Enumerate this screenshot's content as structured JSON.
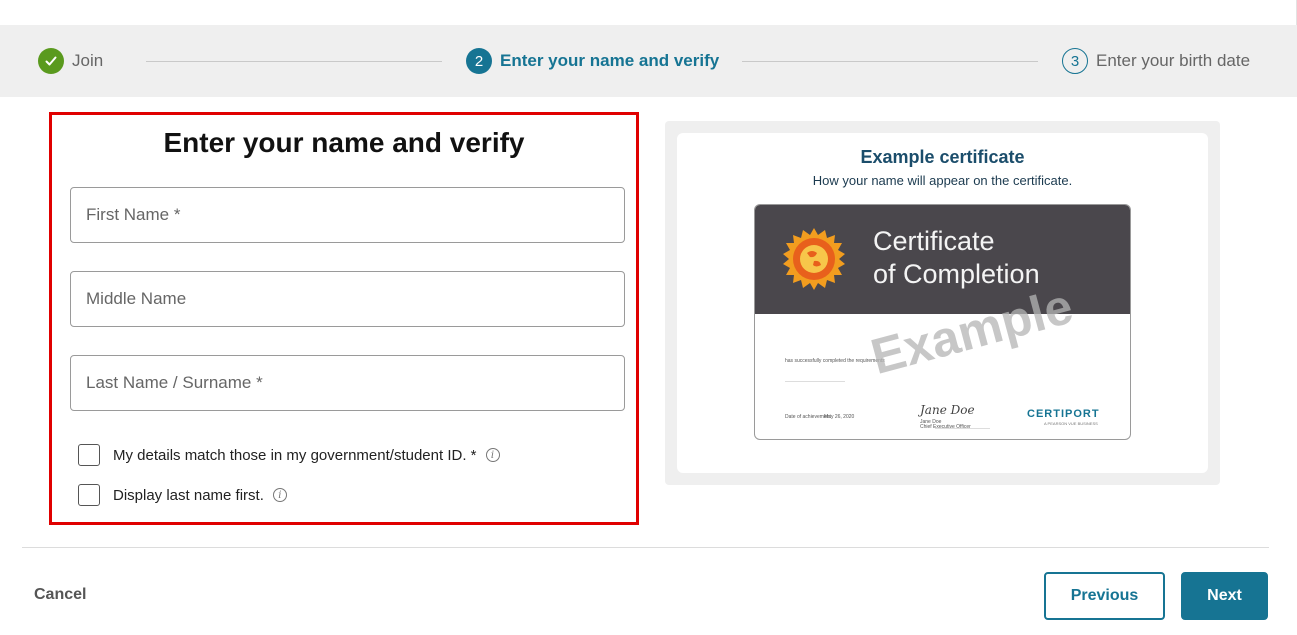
{
  "stepper": {
    "steps": [
      {
        "number": "",
        "label": "Join",
        "state": "complete",
        "icon": "check-icon"
      },
      {
        "number": "2",
        "label": "Enter your name and verify",
        "state": "current"
      },
      {
        "number": "3",
        "label": "Enter your birth date",
        "state": "upcoming"
      }
    ]
  },
  "form": {
    "title": "Enter your name and verify",
    "fields": [
      {
        "placeholder": "First Name *",
        "value": ""
      },
      {
        "placeholder": "Middle Name",
        "value": ""
      },
      {
        "placeholder": "Last Name / Surname *",
        "value": ""
      }
    ],
    "checkboxes": [
      {
        "label": "My details match those in my government/student ID. *",
        "checked": false,
        "icon": "info-icon"
      },
      {
        "label": "Display last name first.",
        "checked": false,
        "icon": "info-icon"
      }
    ]
  },
  "certificate": {
    "title": "Example certificate",
    "subtitle": "How your name will appear on the certificate.",
    "heading_line1": "Certificate",
    "heading_line2": "of Completion",
    "completed_text": "has successfully completed the requirements",
    "date_label": "Date of achievement",
    "date_value": "May 26, 2020",
    "signature": "Jane Doe",
    "signer_name": "Jane Doe",
    "signer_title": "Chief Executive Officer",
    "logo_text": "CERTIPORT",
    "logo_sub": "A PEARSON VUE BUSINESS",
    "watermark": "Example",
    "seal_icon": "globe-seal-icon"
  },
  "footer": {
    "cancel": "Cancel",
    "previous": "Previous",
    "next": "Next"
  },
  "colors": {
    "accent": "#167493",
    "complete": "#5a9a1e",
    "highlight_border": "#e00000",
    "cert_header": "#4a474c"
  }
}
